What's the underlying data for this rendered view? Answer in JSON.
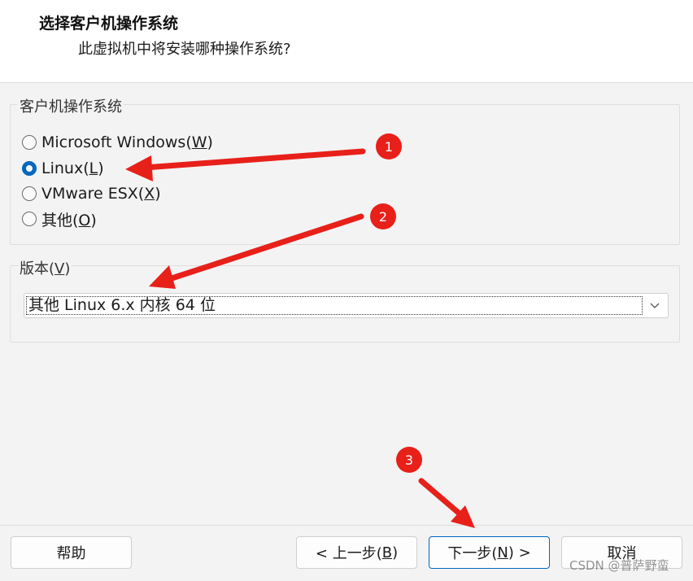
{
  "header": {
    "title": "选择客户机操作系统",
    "subtitle": "此虚拟机中将安装哪种操作系统?"
  },
  "os_group": {
    "label": "客户机操作系统",
    "options": [
      {
        "pre": "Microsoft Windows(",
        "key": "W",
        "post": ")",
        "selected": false
      },
      {
        "pre": "Linux(",
        "key": "L",
        "post": ")",
        "selected": true
      },
      {
        "pre": "VMware ESX(",
        "key": "X",
        "post": ")",
        "selected": false
      },
      {
        "pre": "其他(",
        "key": "O",
        "post": ")",
        "selected": false
      }
    ]
  },
  "version_group": {
    "label_pre": "版本(",
    "label_key": "V",
    "label_post": ")",
    "selected": "其他 Linux 6.x 内核 64 位"
  },
  "buttons": {
    "help": "帮助",
    "back_pre": "< 上一步(",
    "back_key": "B",
    "back_post": ")",
    "next_pre": "下一步(",
    "next_key": "N",
    "next_post": ") >",
    "cancel": "取消"
  },
  "annotations": {
    "badges": [
      "1",
      "2",
      "3"
    ],
    "color": "#e8201a"
  },
  "watermark": "CSDN @普萨野蛮",
  "colors": {
    "accent": "#0067c0",
    "header_bg": "#ffffff",
    "body_bg": "#f3f3f3"
  }
}
